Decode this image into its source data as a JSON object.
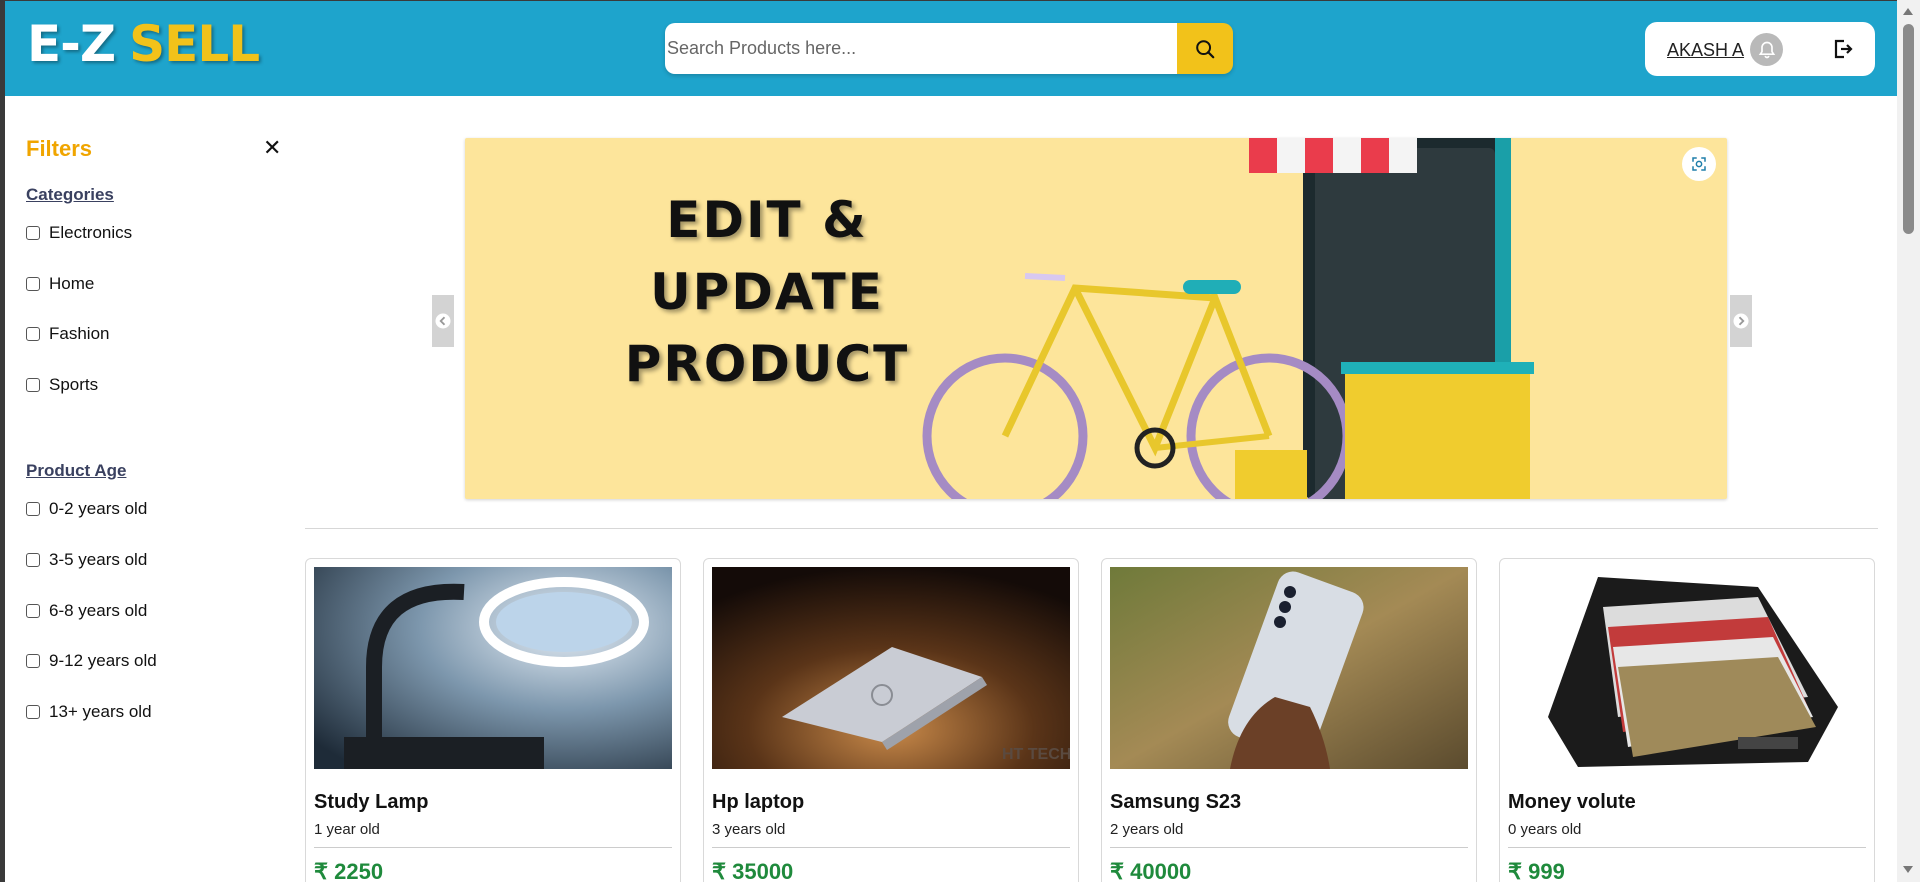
{
  "header": {
    "logo_part1": "E-Z",
    "logo_part2": "SELL",
    "search_placeholder": "Search Products here...",
    "user_name": "AKASH A"
  },
  "sidebar": {
    "title": "Filters",
    "close_symbol": "✕",
    "categories_title": "Categories",
    "categories": [
      "Electronics",
      "Home",
      "Fashion",
      "Sports"
    ],
    "age_title": "Product Age",
    "ages": [
      "0-2 years old",
      "3-5 years old",
      "6-8 years old",
      "9-12 years old",
      "13+ years old"
    ]
  },
  "banner": {
    "line1": "EDIT & UPDATE",
    "line2": "PRODUCT"
  },
  "products": [
    {
      "name": "Study Lamp",
      "age": "1 year old",
      "price": "₹ 2250"
    },
    {
      "name": "Hp laptop",
      "age": "3 years old",
      "price": "₹ 35000"
    },
    {
      "name": "Samsung S23",
      "age": "2 years old",
      "price": "₹ 40000"
    },
    {
      "name": "Money volute",
      "age": "0 years old",
      "price": "₹ 999"
    }
  ],
  "colors": {
    "header_bg": "#1ea4cc",
    "accent_yellow": "#f2c21a",
    "filters_orange": "#f0a500",
    "price_green": "#1f8a3c"
  },
  "icons": [
    "search-icon",
    "bell-icon",
    "logout-icon",
    "close-icon",
    "chevron-left-icon",
    "chevron-right-icon",
    "expand-icon"
  ]
}
